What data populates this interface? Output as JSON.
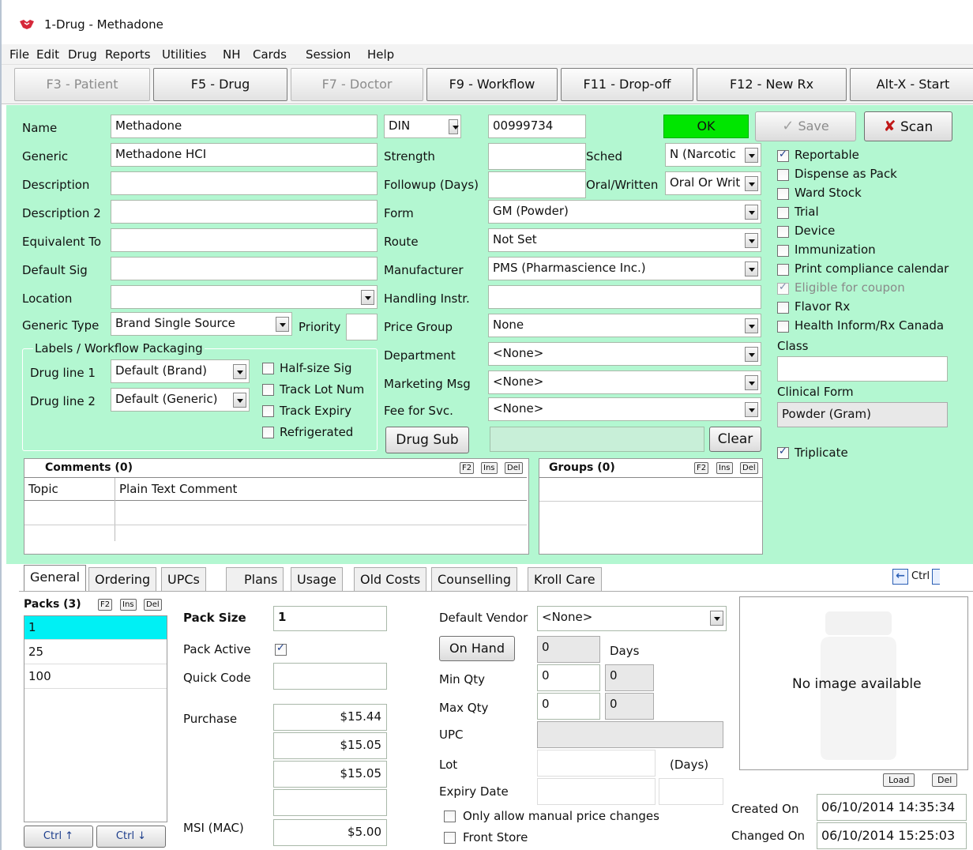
{
  "window": {
    "title": "1-Drug - Methadone"
  },
  "menu": [
    "File",
    "Edit",
    "Drug",
    "Reports",
    "Utilities",
    "NH",
    "Cards",
    "Session",
    "Help"
  ],
  "fkeys": {
    "patient": "F3 - Patient",
    "drug": "F5 - Drug",
    "doctor": "F7 - Doctor",
    "workflow": "F9 - Workflow",
    "dropoff": "F11 - Drop-off",
    "newrx": "F12 - New Rx",
    "start": "Alt-X - Start"
  },
  "form": {
    "name_label": "Name",
    "name_value": "Methadone",
    "generic_label": "Generic",
    "generic_value": "Methadone HCI",
    "description_label": "Description",
    "description_value": "",
    "description2_label": "Description 2",
    "description2_value": "",
    "equivalent_label": "Equivalent To",
    "equivalent_value": "",
    "default_sig_label": "Default Sig",
    "default_sig_value": "",
    "location_label": "Location",
    "location_value": "",
    "generic_type_label": "Generic Type",
    "generic_type_value": "Brand Single Source",
    "priority_label": "Priority",
    "priority_value": "",
    "din_select": "DIN",
    "din_value": "00999734",
    "strength_label": "Strength",
    "strength_value": "",
    "followup_label": "Followup (Days)",
    "followup_value": "",
    "form_label": "Form",
    "form_value": "GM (Powder)",
    "route_label": "Route",
    "route_value": "Not Set",
    "manufacturer_label": "Manufacturer",
    "manufacturer_value": "PMS (Pharmascience Inc.)",
    "handling_label": "Handling Instr.",
    "handling_value": "",
    "price_group_label": "Price Group",
    "price_group_value": "None",
    "department_label": "Department",
    "department_value": "<None>",
    "marketing_label": "Marketing Msg",
    "marketing_value": "<None>",
    "fee_label": "Fee for Svc.",
    "fee_value": "<None>",
    "drug_sub_button": "Drug Sub",
    "drug_sub_value": "",
    "clear_button": "Clear",
    "sched_label": "Sched",
    "sched_value": "N (Narcotic",
    "oral_label": "Oral/Written",
    "oral_value": "Oral Or Writ",
    "ok_status": "OK",
    "save_button": "Save",
    "scan_button": "Scan"
  },
  "labels_group": {
    "title": "Labels / Workflow Packaging",
    "drug_line1_label": "Drug line 1",
    "drug_line1_value": "Default (Brand)",
    "drug_line2_label": "Drug line 2",
    "drug_line2_value": "Default (Generic)",
    "half_size": "Half-size Sig",
    "track_lot": "Track Lot Num",
    "track_expiry": "Track Expiry",
    "refrigerated": "Refrigerated"
  },
  "right_checks": [
    {
      "label": "Reportable",
      "checked": true,
      "disabled": false
    },
    {
      "label": "Dispense as Pack",
      "checked": false,
      "disabled": false
    },
    {
      "label": "Ward Stock",
      "checked": false,
      "disabled": false
    },
    {
      "label": "Trial",
      "checked": false,
      "disabled": false
    },
    {
      "label": "Device",
      "checked": false,
      "disabled": false
    },
    {
      "label": "Immunization",
      "checked": false,
      "disabled": false
    },
    {
      "label": "Print compliance calendar",
      "checked": false,
      "disabled": false
    },
    {
      "label": "Eligible for coupon",
      "checked": true,
      "disabled": true
    },
    {
      "label": "Flavor Rx",
      "checked": false,
      "disabled": false
    },
    {
      "label": "Health Inform/Rx Canada",
      "checked": false,
      "disabled": false
    }
  ],
  "class_label": "Class",
  "class_value": "",
  "clinical_form_label": "Clinical Form",
  "clinical_form_value": "Powder (Gram)",
  "triplicate_label": "Triplicate",
  "comments": {
    "title": "Comments (0)",
    "col_topic": "Topic",
    "col_text": "Plain Text Comment"
  },
  "groups": {
    "title": "Groups (0)"
  },
  "mini": {
    "f2": "F2",
    "ins": "Ins",
    "del": "Del"
  },
  "tabs": [
    "General",
    "Ordering",
    "UPCs",
    "Plans",
    "Usage",
    "Old Costs",
    "Counselling",
    "Kroll Care"
  ],
  "ctrl_label": "Ctrl",
  "packs": {
    "title": "Packs (3)",
    "items": [
      "1",
      "25",
      "100"
    ],
    "up": "Ctrl ↑",
    "down": "Ctrl ↓"
  },
  "pack": {
    "size_label": "Pack Size",
    "size_value": "1",
    "active_label": "Pack Active",
    "quick_label": "Quick Code",
    "quick_value": "",
    "purchase_label": "Purchase",
    "purchase_values": [
      "$15.44",
      "$15.05",
      "$15.05",
      ""
    ],
    "msi_label": "MSI (MAC)",
    "msi_value": "$5.00"
  },
  "stock": {
    "vendor_label": "Default Vendor",
    "vendor_value": "<None>",
    "onhand_button": "On Hand",
    "onhand_value": "0",
    "days_label": "Days",
    "min_label": "Min Qty",
    "min_value": "0",
    "min_value2": "0",
    "max_label": "Max Qty",
    "max_value": "0",
    "max_value2": "0",
    "upc_label": "UPC",
    "upc_value": "",
    "lot_label": "Lot",
    "lot_value": "",
    "lot_days_label": "(Days)",
    "expiry_label": "Expiry Date",
    "expiry_value": "",
    "expiry_days": "",
    "manual_price": "Only allow manual price changes",
    "front_store": "Front Store"
  },
  "image": {
    "text": "No image available",
    "load": "Load",
    "del": "Del"
  },
  "audit": {
    "created_label": "Created On",
    "created_value": "06/10/2014 14:35:34",
    "changed_label": "Changed On",
    "changed_value": "06/10/2014 15:25:03"
  }
}
